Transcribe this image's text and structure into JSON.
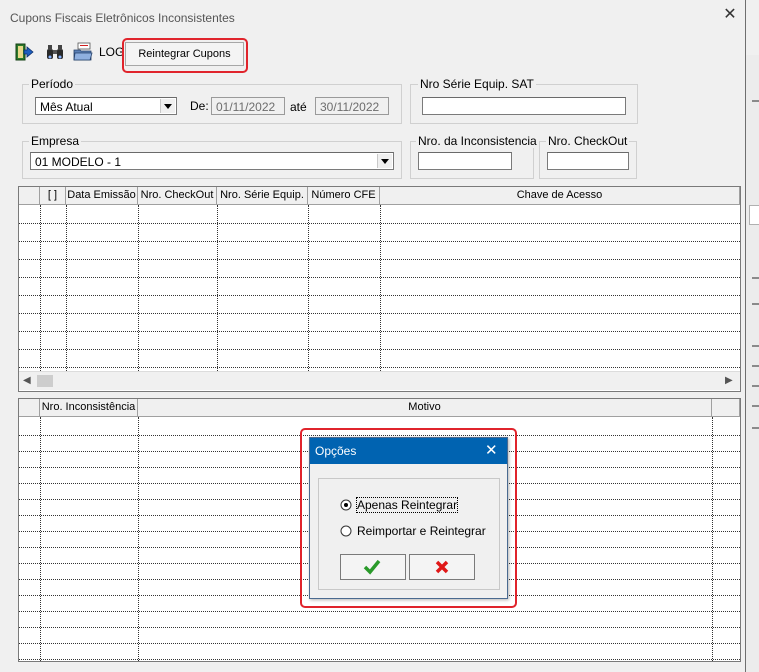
{
  "window": {
    "title": "Cupons Fiscais Eletrônicos Inconsistentes",
    "close_glyph": "✕"
  },
  "toolbar": {
    "log_label": "LOG",
    "reintegrar_label": "Reintegrar Cupons"
  },
  "filters": {
    "periodo_label": "Período",
    "periodo_value": "Mês Atual",
    "de_label": "De:",
    "de_value": "01/11/2022",
    "ate_label": "até",
    "ate_value": "30/11/2022",
    "nro_serie_sat_label": "Nro Série Equip. SAT",
    "nro_serie_sat_value": "",
    "empresa_label": "Empresa",
    "empresa_value": "01 MODELO - 1",
    "nro_inconsistencia_label": "Nro. da Inconsistencia",
    "nro_inconsistencia_value": "",
    "nro_checkout_label": "Nro. CheckOut",
    "nro_checkout_value": ""
  },
  "grid_cupons": {
    "columns": [
      "[ ]",
      "Data Emissão",
      "Nro. CheckOut",
      "Nro. Série Equip.",
      "Número CFE",
      "Chave de Acesso"
    ]
  },
  "grid_inconsistencias": {
    "columns": [
      "Nro. Inconsistência",
      "Motivo"
    ]
  },
  "dialog": {
    "title": "Opções",
    "close_glyph": "✕",
    "options": [
      "Apenas Reintegrar",
      "Reimportar e Reintegrar"
    ],
    "selected_option": "Apenas Reintegrar"
  },
  "colors": {
    "highlight": "#e0242c",
    "dialog_title": "#0063b1",
    "ok": "#2a9a2a",
    "cancel": "#e01818"
  }
}
